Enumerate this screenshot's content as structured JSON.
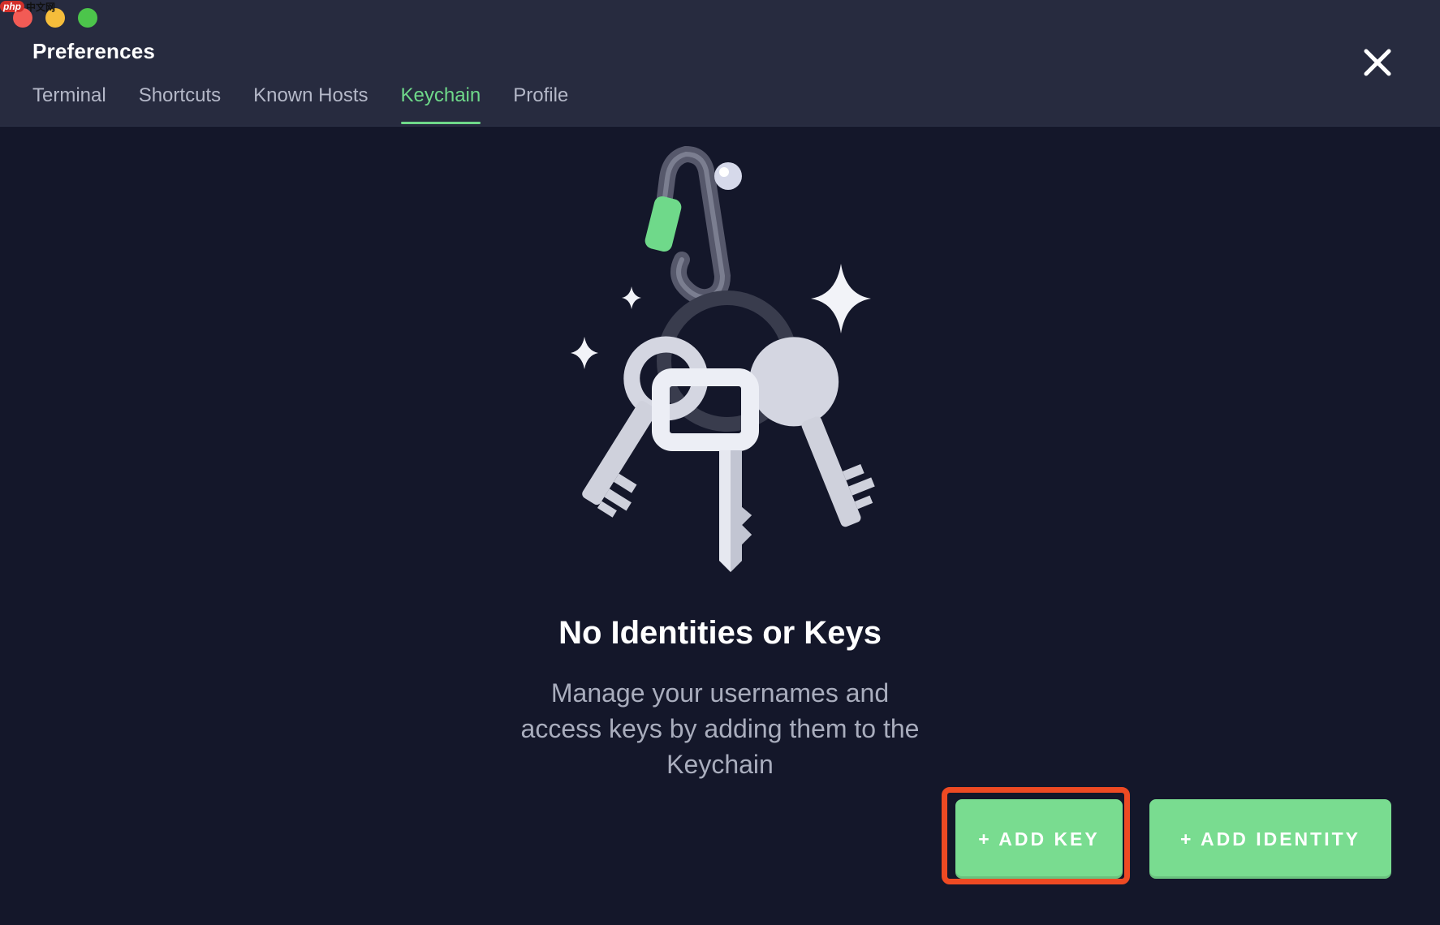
{
  "window": {
    "title": "Preferences",
    "controls": [
      "close",
      "minimize",
      "zoom"
    ]
  },
  "watermark": {
    "brand": "php",
    "site": "中文网"
  },
  "tabs": [
    {
      "label": "Terminal",
      "active": false
    },
    {
      "label": "Shortcuts",
      "active": false
    },
    {
      "label": "Known Hosts",
      "active": false
    },
    {
      "label": "Keychain",
      "active": true
    },
    {
      "label": "Profile",
      "active": false
    }
  ],
  "close_icon": "close-icon",
  "empty_state": {
    "illustration": "keychain-keys-illustration",
    "title": "No Identities or Keys",
    "description": "Manage your usernames and access keys by adding them to the Keychain"
  },
  "actions": {
    "add_key_label": "+ ADD KEY",
    "add_identity_label": "+ ADD IDENTITY"
  },
  "colors": {
    "accent": "#6fd98a",
    "button": "#79dc90",
    "highlight": "#ee4a23",
    "header_bg": "#272b3f",
    "body_bg": "#14172a"
  }
}
